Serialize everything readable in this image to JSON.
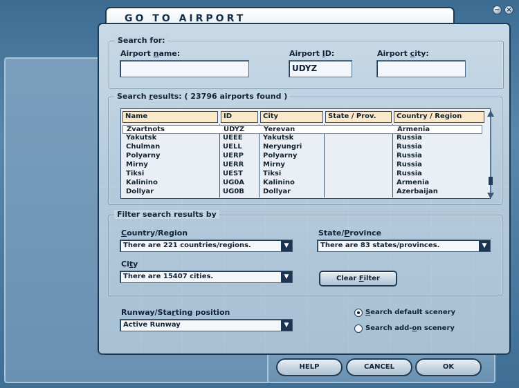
{
  "window_controls": {
    "minimize": "−",
    "close": "×"
  },
  "title": "GO TO AIRPORT",
  "search_for": {
    "legend": "Search for:",
    "airport_name": {
      "label_pre": "Airport ",
      "label_key": "n",
      "label_post": "ame:",
      "value": ""
    },
    "airport_id": {
      "label_pre": "Airport ",
      "label_key": "I",
      "label_post": "D:",
      "value": "UDYZ"
    },
    "airport_city": {
      "label_pre": "Airport ",
      "label_key": "c",
      "label_post": "ity:",
      "value": ""
    }
  },
  "results": {
    "legend_pre": "Search ",
    "legend_key": "r",
    "legend_post": "esults: ( 23796 airports found )",
    "columns": [
      "Name",
      "ID",
      "City",
      "State / Prov.",
      "Country / Region"
    ],
    "rows": [
      [
        "Zvartnots",
        "UDYZ",
        "Yerevan",
        "",
        "Armenia"
      ],
      [
        "Yakutsk",
        "UEEE",
        "Yakutsk",
        "",
        "Russia"
      ],
      [
        "Chulman",
        "UELL",
        "Neryungri",
        "",
        "Russia"
      ],
      [
        "Polyarny",
        "UERP",
        "Polyarny",
        "",
        "Russia"
      ],
      [
        "Mirny",
        "UERR",
        "Mirny",
        "",
        "Russia"
      ],
      [
        "Tiksi",
        "UEST",
        "Tiksi",
        "",
        "Russia"
      ],
      [
        "Kalinino",
        "UG0A",
        "Kalinino",
        "",
        "Armenia"
      ],
      [
        "Dollyar",
        "UG0B",
        "Dollyar",
        "",
        "Azerbaijan"
      ]
    ],
    "selected_index": 0
  },
  "filter": {
    "legend": "Filter search results by",
    "country": {
      "label_key": "C",
      "label_post": "ountry/Region",
      "value": "There are 221 countries/regions."
    },
    "state": {
      "label_pre": "State/",
      "label_key": "P",
      "label_post": "rovince",
      "value": "There are 83 states/provinces."
    },
    "city": {
      "label_pre": "Ci",
      "label_key": "t",
      "label_post": "y",
      "value": "There are 15407 cities."
    },
    "clear_button": {
      "label_pre": "Clear ",
      "label_key": "F",
      "label_post": "ilter"
    }
  },
  "runway": {
    "label_pre": "Runway/Sta",
    "label_key": "r",
    "label_post": "ting position",
    "value": "Active Runway"
  },
  "scenery": {
    "default": {
      "label_key": "S",
      "label_post": "earch default scenery",
      "selected": true
    },
    "addon": {
      "label_pre": "Search add-",
      "label_key": "o",
      "label_post": "n scenery",
      "selected": false
    }
  },
  "buttons": {
    "help": "HELP",
    "cancel": "CANCEL",
    "ok": "OK"
  },
  "colors": {
    "accent": "#1e3a52",
    "header_fill": "#fbe8c8",
    "background": "#4f7fa4"
  }
}
